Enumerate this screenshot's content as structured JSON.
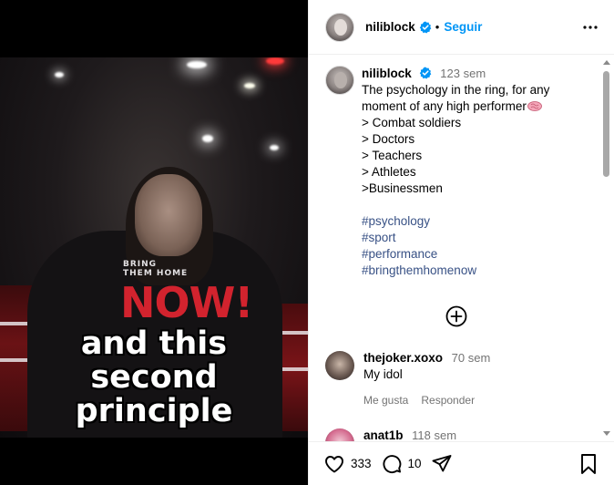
{
  "video": {
    "caption_line1": "and this",
    "caption_line2": "second",
    "caption_line3": "principle",
    "shirt_text_line1": "BRING",
    "shirt_text_line2": "THEM HOME",
    "shirt_text_big": "NOW!"
  },
  "header": {
    "username": "niliblock",
    "separator": "•",
    "follow_label": "Seguir",
    "more_icon": "more-horizontal-icon"
  },
  "post": {
    "username": "niliblock",
    "time": "123 sem",
    "caption": "The psychology in the ring, for any moment of any high performer",
    "list": "> Combat soldiers\n> Doctors\n> Teachers\n> Athletes\n>Businessmen",
    "hashtags": [
      "#psychology",
      "#sport",
      "#performance",
      "#bringthemhomenow"
    ]
  },
  "comments": [
    {
      "username": "thejoker.xoxo",
      "time": "70 sem",
      "text": "My idol",
      "like_label": "Me gusta",
      "reply_label": "Responder"
    },
    {
      "username": "anat1b",
      "time": "118 sem"
    }
  ],
  "actions": {
    "likes": "333",
    "comments": "10"
  },
  "colors": {
    "follow": "#0095f6",
    "hashtag": "#385185",
    "muted": "#737373",
    "verified": "#0095f6"
  }
}
